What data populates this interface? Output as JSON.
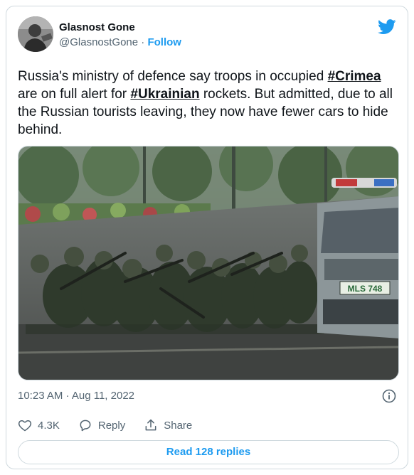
{
  "author": {
    "display_name": "Glasnost Gone",
    "handle": "@GlasnostGone",
    "separator": " · ",
    "follow_label": "Follow"
  },
  "tweet": {
    "text_1": "Russia's ministry of defence say troops in occupied ",
    "hashtag_1": "#Crimea",
    "text_2": " are on full alert for ",
    "hashtag_2": "#Ukrainian",
    "text_3": " rockets. But admitted, due to all the Russian tourists leaving, they now have fewer cars to hide behind."
  },
  "photo": {
    "license_plate": "MLS 748"
  },
  "meta": {
    "timestamp": "10:23 AM · Aug 11, 2022"
  },
  "actions": {
    "like_count": "4.3K",
    "reply_label": "Reply",
    "share_label": "Share"
  },
  "read_replies_label": "Read 128 replies",
  "colors": {
    "accent": "#1d9bf0",
    "text_primary": "#0f1419",
    "text_secondary": "#536471",
    "border": "#cfd9de"
  },
  "icons": [
    "twitter-bird-icon",
    "info-icon",
    "heart-icon",
    "reply-icon",
    "share-icon"
  ]
}
